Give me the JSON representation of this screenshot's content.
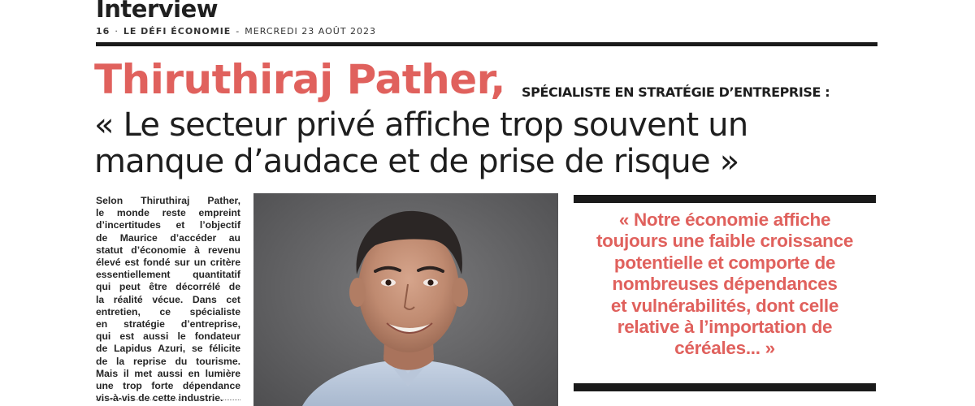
{
  "header": {
    "section": "Interview",
    "page_number": "16",
    "publication": "LE DÉFI ÉCONOMIE",
    "date": "MERCREDI 23 AOÛT 2023"
  },
  "headline": {
    "name": "Thiruthiraj Pather,",
    "role": "SPÉCIALISTE EN STRATÉGIE D’ENTREPRISE :",
    "quote_lines": [
      "« Le secteur privé affiche trop souvent un",
      "manque d’audace et de prise de risque »"
    ]
  },
  "lead": {
    "lines": [
      "Selon Thiruthiraj Pather,",
      "le monde reste empreint",
      "d’incertitudes et l’objectif",
      "de Maurice d’accéder au",
      "statut d’économie à revenu",
      "élevé est fondé sur un critère",
      "essentiellement quantitatif",
      "qui peut être décorrélé de",
      "la réalité vécue. Dans cet",
      "entretien, ce spécialiste",
      "en stratégie d’entreprise,",
      "qui est aussi le fondateur",
      "de Lapidus Azuri, se félicite",
      "de la reprise du tourisme.",
      "Mais il met aussi en lumière",
      "une trop forte dépendance",
      "vis-à-vis de cette industrie."
    ]
  },
  "pullquote": {
    "lines": [
      "« Notre économie affiche",
      "toujours une faible croissance",
      "potentielle et comporte de",
      "nombreuses dépendances",
      "et vulnérabilités, dont celle",
      "relative à l’importation de",
      "céréales... »"
    ]
  },
  "colors": {
    "accent": "#e0615d",
    "ink": "#1e1e1e",
    "rule": "#1a1a1a"
  }
}
